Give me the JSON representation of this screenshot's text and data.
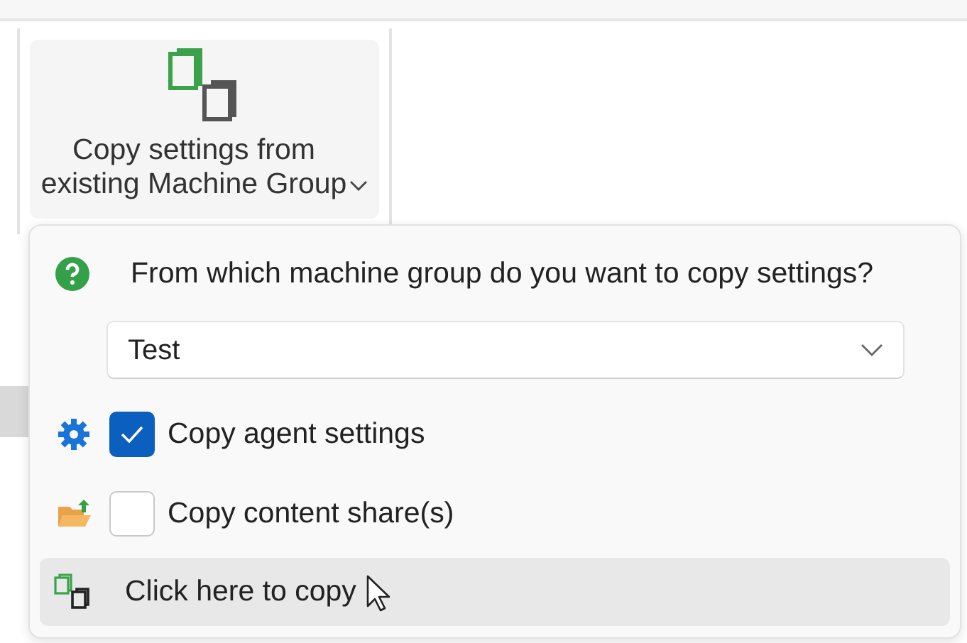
{
  "ribbon": {
    "button": {
      "label": "Copy settings from\nexisting Machine Group"
    }
  },
  "popup": {
    "question": "From which machine group do you want to copy settings?",
    "group_select": {
      "value": "Test"
    },
    "options": [
      {
        "kind": "gear",
        "label": "Copy agent settings",
        "checked": true
      },
      {
        "kind": "folder",
        "label": "Copy content share(s)",
        "checked": false
      }
    ],
    "copy_button": {
      "label": "Click here to copy",
      "hovered": true
    }
  }
}
